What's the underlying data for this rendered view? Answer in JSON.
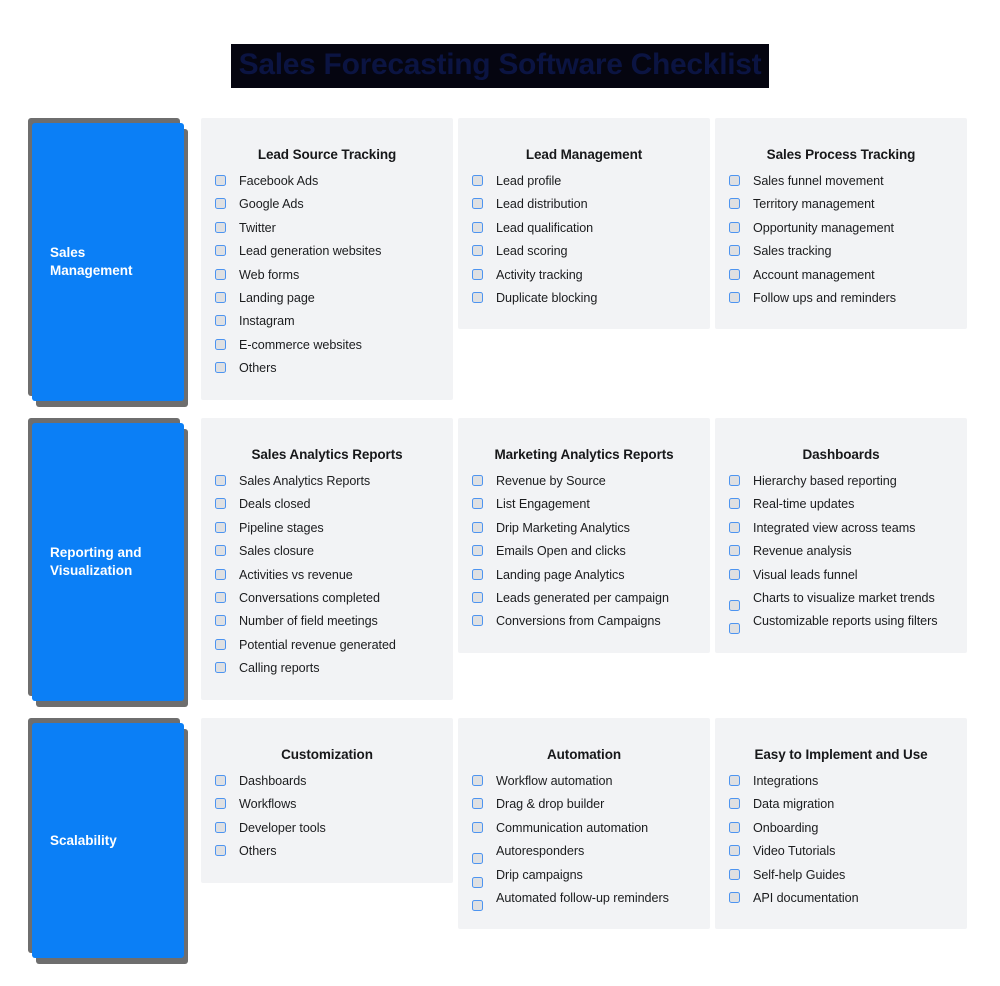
{
  "title": "Sales Forecasting Software Checklist",
  "colors": {
    "accent_blue": "#0b7ff6",
    "card_bg": "#f2f3f5",
    "checkbox_border": "#4d94f0",
    "checkbox_fill": "#dfe0e2",
    "title_highlight": "#050510",
    "title_text": "#0b1442",
    "shadow_gray": "#6e6e6e",
    "page_bg": "#ffffff"
  },
  "rows": [
    {
      "category": "Sales\nManagement",
      "category_lines": [
        "Sales",
        "Management"
      ],
      "cards": [
        {
          "title": "Lead Source Tracking",
          "items": [
            "Facebook Ads",
            "Google Ads",
            "Twitter",
            "Lead generation websites",
            "Web forms",
            "Landing page",
            "Instagram",
            "E-commerce websites",
            "Others"
          ]
        },
        {
          "title": "Lead Management",
          "items": [
            "Lead profile",
            "Lead distribution",
            "Lead qualification",
            "Lead scoring",
            "Activity tracking",
            "Duplicate blocking"
          ]
        },
        {
          "title": "Sales Process Tracking",
          "items": [
            "Sales funnel movement",
            "Territory management",
            "Opportunity management",
            "Sales tracking",
            "Account management",
            "Follow ups and reminders"
          ]
        }
      ]
    },
    {
      "category": "Reporting and\nVisualization",
      "category_lines": [
        "Reporting and",
        "Visualization"
      ],
      "cards": [
        {
          "title": "Sales Analytics Reports",
          "items": [
            "Sales Analytics Reports",
            "Deals closed",
            "Pipeline stages",
            "Sales closure",
            "Activities vs revenue",
            "Conversations completed",
            "Number of field meetings",
            "Potential revenue generated",
            "Calling reports"
          ]
        },
        {
          "title": "Marketing Analytics Reports",
          "items": [
            "Revenue by Source",
            "List Engagement",
            "Drip Marketing Analytics",
            "Emails Open and clicks",
            "Landing page Analytics",
            "Leads generated per campaign",
            "Conversions from Campaigns"
          ]
        },
        {
          "title": "Dashboards",
          "items": [
            "Hierarchy based reporting",
            "Real-time updates",
            "Integrated view across teams",
            "Revenue analysis",
            "Visual leads funnel",
            "Charts to visualize market trends",
            "Customizable reports using filters"
          ]
        }
      ]
    },
    {
      "category": "Scalability",
      "category_lines": [
        "Scalability"
      ],
      "cards": [
        {
          "title": "Customization",
          "items": [
            "Dashboards",
            "Workflows",
            "Developer tools",
            "Others"
          ]
        },
        {
          "title": "Automation",
          "items": [
            "Workflow automation",
            "Drag & drop builder",
            "Communication automation",
            "Autoresponders",
            "Drip campaigns",
            "Automated follow-up reminders"
          ]
        },
        {
          "title": "Easy to Implement and Use",
          "items": [
            "Integrations",
            "Data migration",
            "Onboarding",
            "Video Tutorials",
            "Self-help Guides",
            "API documentation"
          ]
        }
      ]
    }
  ]
}
